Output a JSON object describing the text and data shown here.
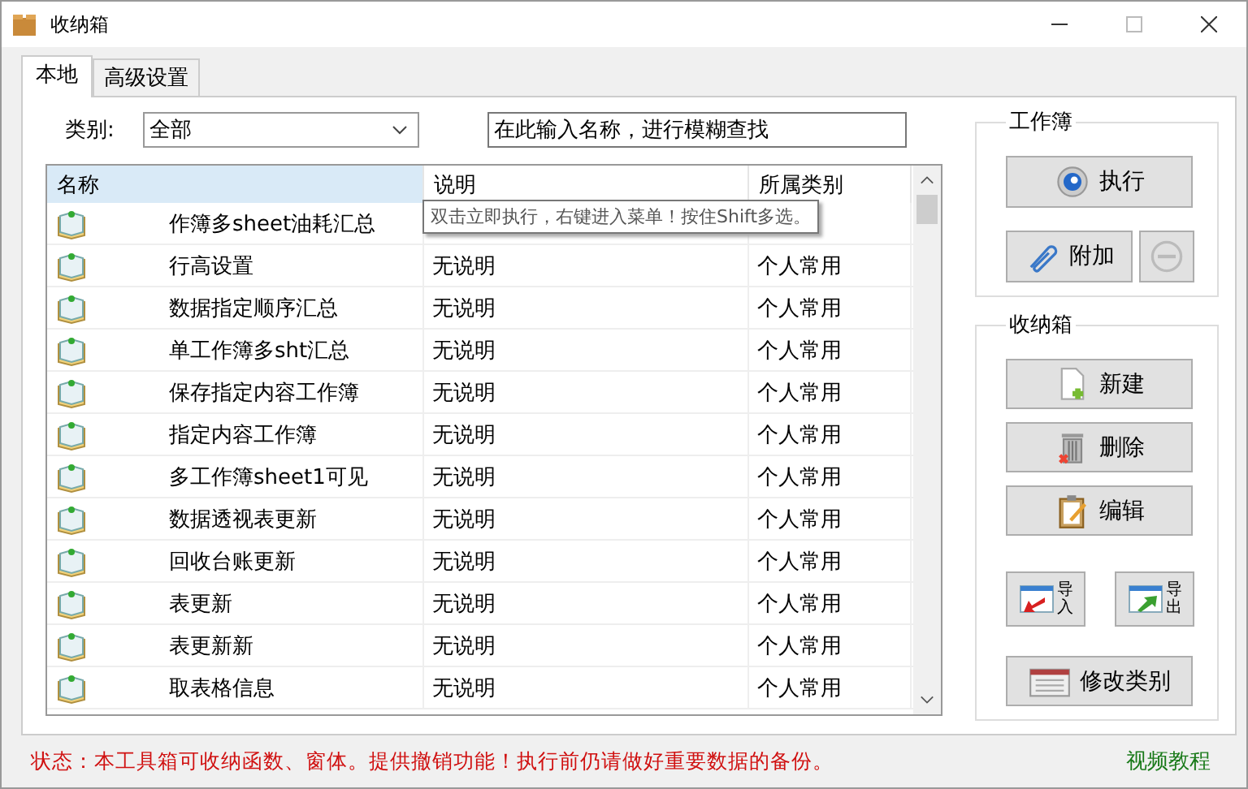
{
  "window": {
    "title": "收纳箱"
  },
  "tabs": [
    {
      "label": "本地",
      "selected": true
    },
    {
      "label": "高级设置",
      "selected": false
    }
  ],
  "filter": {
    "label": "类别:",
    "value": "全部"
  },
  "search": {
    "placeholder": "在此输入名称，进行模糊查找"
  },
  "table": {
    "columns": [
      "名称",
      "说明",
      "所属类别"
    ],
    "rows": [
      {
        "name": "作簿多sheet油耗汇总"
      },
      {
        "name": "行高设置",
        "description": "无说明",
        "category": "个人常用"
      },
      {
        "name": "数据指定顺序汇总",
        "description": "无说明",
        "category": "个人常用"
      },
      {
        "name": "单工作簿多sht汇总",
        "description": "无说明",
        "category": "个人常用"
      },
      {
        "name": "保存指定内容工作簿",
        "description": "无说明",
        "category": "个人常用"
      },
      {
        "name": "指定内容工作簿",
        "description": "无说明",
        "category": "个人常用"
      },
      {
        "name": "多工作簿sheet1可见",
        "description": "无说明",
        "category": "个人常用"
      },
      {
        "name": "数据透视表更新",
        "description": "无说明",
        "category": "个人常用"
      },
      {
        "name": "回收台账更新",
        "description": "无说明",
        "category": "个人常用"
      },
      {
        "name": "表更新",
        "description": "无说明",
        "category": "个人常用"
      },
      {
        "name": "表更新新",
        "description": "无说明",
        "category": "个人常用"
      },
      {
        "name": "取表格信息",
        "description": "无说明",
        "category": "个人常用"
      }
    ]
  },
  "tooltip": "双击立即执行，右键进入菜单！按住Shift多选。",
  "workbook_group": {
    "title": "工作簿",
    "run": "执行",
    "attach": "附加"
  },
  "box_group": {
    "title": "收纳箱",
    "new": "新建",
    "delete": "删除",
    "edit": "编辑",
    "import": "导入",
    "export": "导出",
    "change_category": "修改类别"
  },
  "status_bar": {
    "text": "状态：本工具箱可收纳函数、窗体。提供撤销功能！执行前仍请做好重要数据的备份。",
    "link": "视频教程"
  }
}
